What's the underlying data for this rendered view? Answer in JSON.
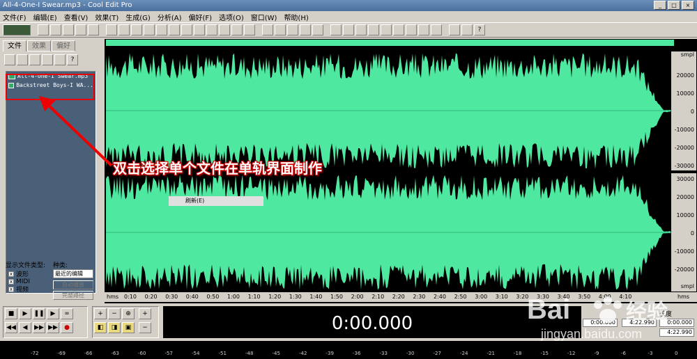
{
  "window": {
    "title": "All-4-One-I Swear.mp3 - Cool Edit Pro",
    "controls": [
      "_",
      "□",
      "×"
    ]
  },
  "menu": [
    "文件(F)",
    "编辑(E)",
    "查看(V)",
    "效果(T)",
    "生成(G)",
    "分析(A)",
    "偏好(F)",
    "选项(O)",
    "窗口(W)",
    "帮助(H)"
  ],
  "panel": {
    "tabs": [
      "文件",
      "效果",
      "偏好"
    ],
    "files": [
      "All-4-One-I Swear.mp3",
      "Backstreet Boys-I WA..."
    ],
    "filetype_label": "显示文件类型:",
    "filetypes": [
      "波形",
      "MIDI",
      "视频"
    ],
    "sort_label": "种类:",
    "sort_value": "最近的编辑",
    "auto_play": "自动播放",
    "full_path": "完整路径"
  },
  "wave": {
    "unit_top": "smpl",
    "unit_bottom": "smpl",
    "ch1_ticks": [
      "20000",
      "10000",
      "0",
      "-10000",
      "-20000",
      "-30000"
    ],
    "ch2_ticks": [
      "30000",
      "20000",
      "10000",
      "0",
      "-10000",
      "-20000"
    ],
    "time_unit": "hms",
    "time_ticks": [
      "0:10",
      "0:20",
      "0:30",
      "0:40",
      "0:50",
      "1:00",
      "1:10",
      "1:20",
      "1:30",
      "1:40",
      "1:50",
      "2:00",
      "2:10",
      "2:20",
      "2:30",
      "2:40",
      "2:50",
      "3:00",
      "3:10",
      "3:20",
      "3:30",
      "3:40",
      "3:50",
      "4:00",
      "4:10"
    ],
    "hms_right": "hms",
    "context_item": "刷新(E)",
    "color": "#4fe8a0"
  },
  "annotation": "双击选择单个文件在单轨界面制作",
  "time_display": "0:00.000",
  "selection": {
    "header_length": "长度",
    "begin": "0:00.000",
    "end": "4:22.990",
    "length_a": "0:00.000",
    "length_b": "4:22.990"
  },
  "levels": [
    "-72",
    "-69",
    "-66",
    "-63",
    "-60",
    "-57",
    "-54",
    "-51",
    "-48",
    "-45",
    "-42",
    "-39",
    "-36",
    "-33",
    "-30",
    "-27",
    "-24",
    "-21",
    "-18",
    "-15",
    "-12",
    "-9",
    "-6",
    "-3",
    "0"
  ],
  "watermark": {
    "brand": "Bai",
    "cn": "经验",
    "url": "jingyan.baidu.com"
  }
}
